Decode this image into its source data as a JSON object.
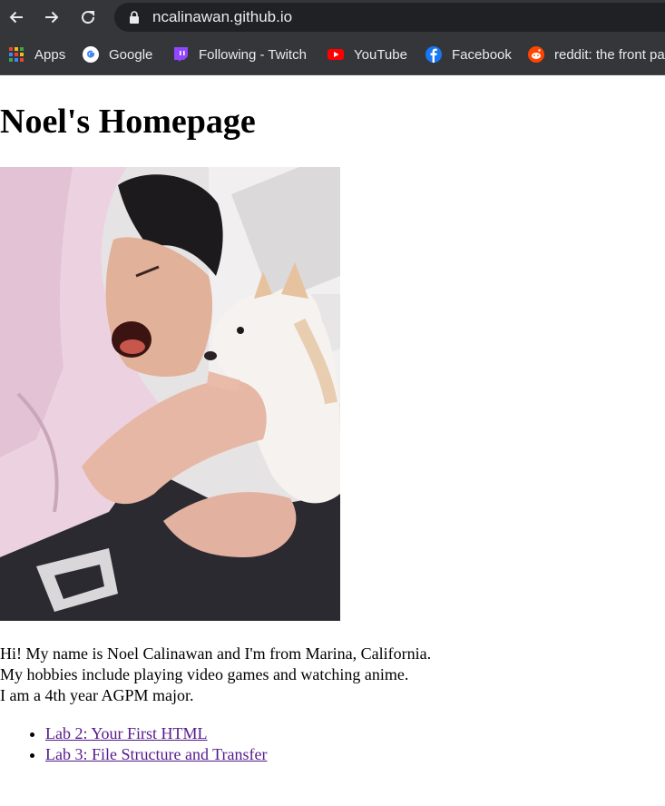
{
  "browser": {
    "url": "ncalinawan.github.io",
    "bookmarks": [
      {
        "label": "Apps",
        "icon": "apps-grid-icon"
      },
      {
        "label": "Google",
        "icon": "google-icon"
      },
      {
        "label": "Following - Twitch",
        "icon": "twitch-icon"
      },
      {
        "label": "YouTube",
        "icon": "youtube-icon"
      },
      {
        "label": "Facebook",
        "icon": "facebook-icon"
      },
      {
        "label": "reddit: the front pa",
        "icon": "reddit-icon"
      }
    ]
  },
  "page": {
    "title": "Noel's Homepage",
    "intro_lines": [
      "Hi! My name is Noel Calinawan and I'm from Marina, California.",
      "My hobbies include playing video games and watching anime.",
      "I am a 4th year AGPM major."
    ],
    "links": [
      "Lab 2: Your First HTML",
      "Lab 3: File Structure and Transfer"
    ]
  },
  "colors": {
    "chrome": "#35363a",
    "omnibox": "#202124",
    "visited_link": "#551a8b"
  }
}
